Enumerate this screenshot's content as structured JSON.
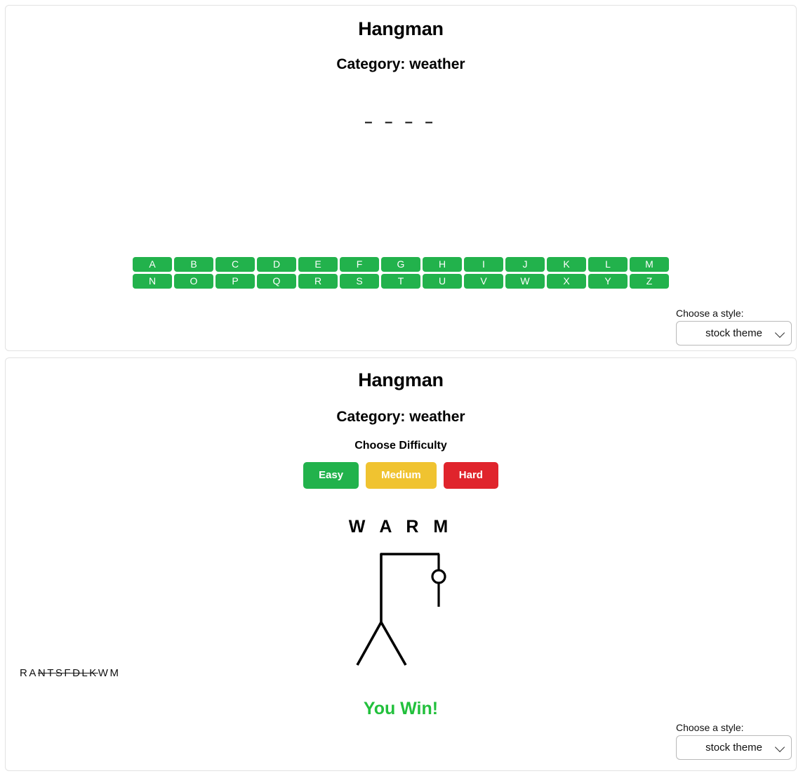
{
  "top_panel": {
    "title": "Hangman",
    "category": "Category:  weather",
    "word_blanks": "– – – –",
    "keyboard": {
      "row1": [
        "A",
        "B",
        "C",
        "D",
        "E",
        "F",
        "G",
        "H",
        "I",
        "J",
        "K",
        "L",
        "M"
      ],
      "row2": [
        "N",
        "O",
        "P",
        "Q",
        "R",
        "S",
        "T",
        "U",
        "V",
        "W",
        "X",
        "Y",
        "Z"
      ],
      "key_color": "#22b24c",
      "key_text_color": "#ffffff"
    },
    "style_chooser": {
      "label": "Choose a style:",
      "selected": "stock theme",
      "options": [
        "stock theme"
      ],
      "chevron_icon": "chevron-down-icon"
    }
  },
  "bottom_panel": {
    "title": "Hangman",
    "category": "Category:  weather",
    "difficulty": {
      "label": "Choose Difficulty",
      "buttons": [
        {
          "label": "Easy",
          "color": "#22b24c"
        },
        {
          "label": "Medium",
          "color": "#f0c330"
        },
        {
          "label": "Hard",
          "color": "#e0242c"
        }
      ]
    },
    "word_reveal": "W A R M",
    "gallows": {
      "icon": "hangman-gallows-icon",
      "stroke_color": "#000000",
      "parts_drawn": [
        "beam",
        "post",
        "legs",
        "rope",
        "head",
        "body"
      ]
    },
    "guessed_letters": {
      "letters": [
        {
          "char": "R",
          "correct": true
        },
        {
          "char": "A",
          "correct": true
        },
        {
          "char": "N",
          "correct": false
        },
        {
          "char": "T",
          "correct": false
        },
        {
          "char": "S",
          "correct": false
        },
        {
          "char": "F",
          "correct": false
        },
        {
          "char": "D",
          "correct": false
        },
        {
          "char": "L",
          "correct": false
        },
        {
          "char": "K",
          "correct": false
        },
        {
          "char": "W",
          "correct": true
        },
        {
          "char": "M",
          "correct": true
        }
      ]
    },
    "result": {
      "text": "You Win!",
      "color": "#22c03c"
    },
    "style_chooser": {
      "label": "Choose a style:",
      "selected": "stock theme",
      "options": [
        "stock theme"
      ],
      "chevron_icon": "chevron-down-icon"
    }
  }
}
